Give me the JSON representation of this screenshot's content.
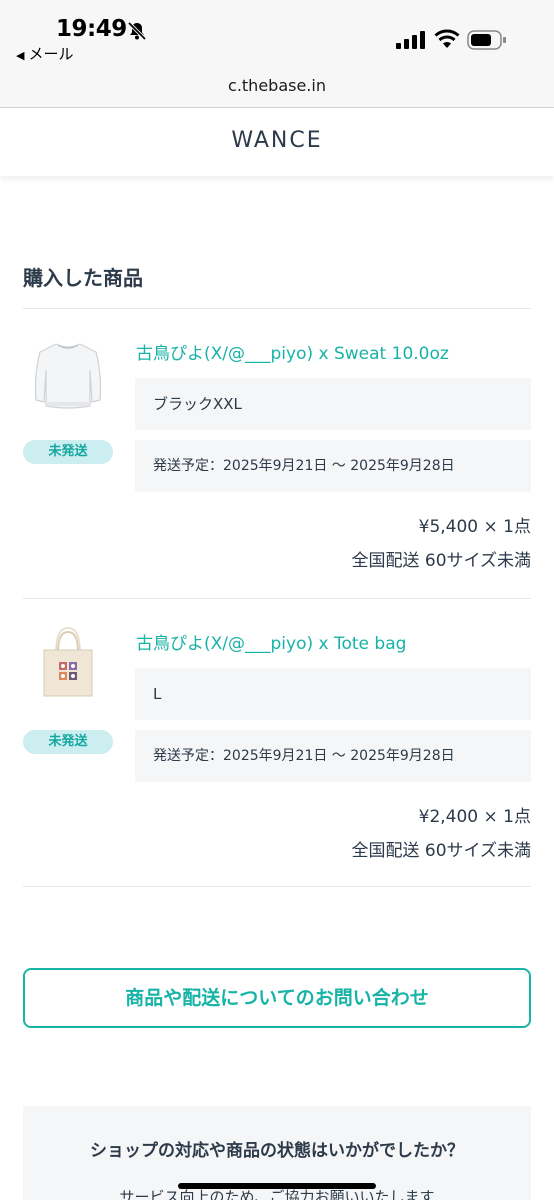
{
  "status_bar": {
    "time": "19:49",
    "back_label": "メール",
    "icons": [
      "bell-slash-icon",
      "signal-icon",
      "wifi-icon",
      "battery-icon"
    ]
  },
  "browser": {
    "url": "c.thebase.in"
  },
  "shop": {
    "name": "WANCE"
  },
  "section_title": "購入した商品",
  "items": [
    {
      "name": "古鳥ぴよ(X/@___piyo) x Sweat 10.0oz",
      "variant": "ブラックXXL",
      "schedule": "発送予定：2025年9月21日 〜 2025年9月28日",
      "status": "未発送",
      "price": "¥5,400 × 1点",
      "shipping": "全国配送 60サイズ未満"
    },
    {
      "name": "古鳥ぴよ(X/@___piyo) x Tote bag",
      "variant": "L",
      "schedule": "発送予定：2025年9月21日 〜 2025年9月28日",
      "status": "未発送",
      "price": "¥2,400 × 1点",
      "shipping": "全国配送 60サイズ未満"
    }
  ],
  "inquiry_button": "商品や配送についてのお問い合わせ",
  "survey": {
    "title": "ショップの対応や商品の状態はいかがでしたか？",
    "subtitle": "サービス向上のため、ご協力お願いいたします"
  },
  "colors": {
    "accent": "#17b3a6",
    "badge_bg": "#cdeef0",
    "text": "#2d3a4a"
  }
}
